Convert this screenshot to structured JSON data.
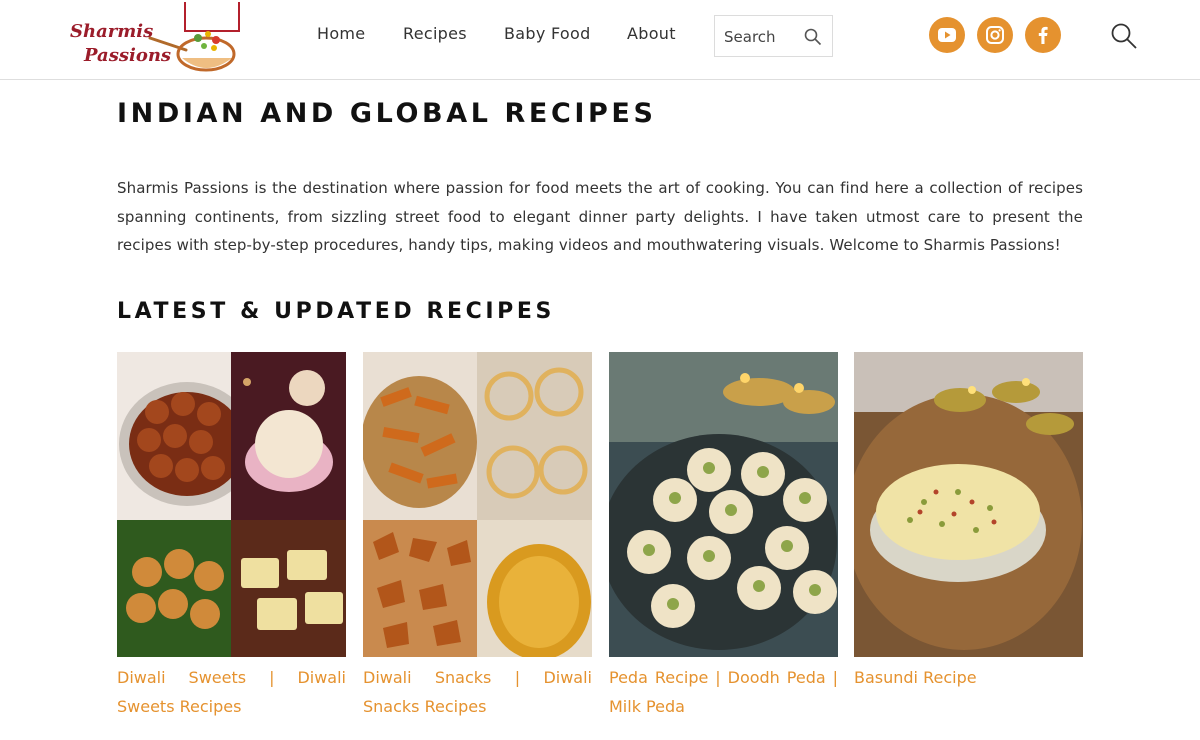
{
  "header": {
    "logo": {
      "line1": "Sharmis",
      "line2": "Passions"
    },
    "nav": [
      {
        "label": "Home"
      },
      {
        "label": "Recipes"
      },
      {
        "label": "Baby Food"
      },
      {
        "label": "About"
      }
    ],
    "search": {
      "placeholder": "Search",
      "icon": "search-icon"
    },
    "social": [
      {
        "name": "youtube",
        "icon": "youtube-icon"
      },
      {
        "name": "instagram",
        "icon": "instagram-icon"
      },
      {
        "name": "facebook",
        "icon": "facebook-icon"
      }
    ],
    "accent_color": "#e5922f"
  },
  "main": {
    "title": "INDIAN AND GLOBAL RECIPES",
    "intro": "Sharmis Passions is the destination where passion for food meets the art of cooking. You can find here a collection of recipes spanning continents, from sizzling street food to elegant dinner party delights. I have taken utmost care to present the recipes with step-by-step procedures, handy tips, making videos and mouthwatering visuals. Welcome to Sharmis Passions!",
    "latest_heading": "LATEST & UPDATED RECIPES",
    "cards": [
      {
        "title": "Diwali Sweets | Diwali Sweets Recipes"
      },
      {
        "title": "Diwali Snacks | Diwali Snacks Recipes"
      },
      {
        "title": "Peda Recipe | Doodh Peda | Milk Peda"
      },
      {
        "title": "Basundi Recipe"
      }
    ]
  }
}
